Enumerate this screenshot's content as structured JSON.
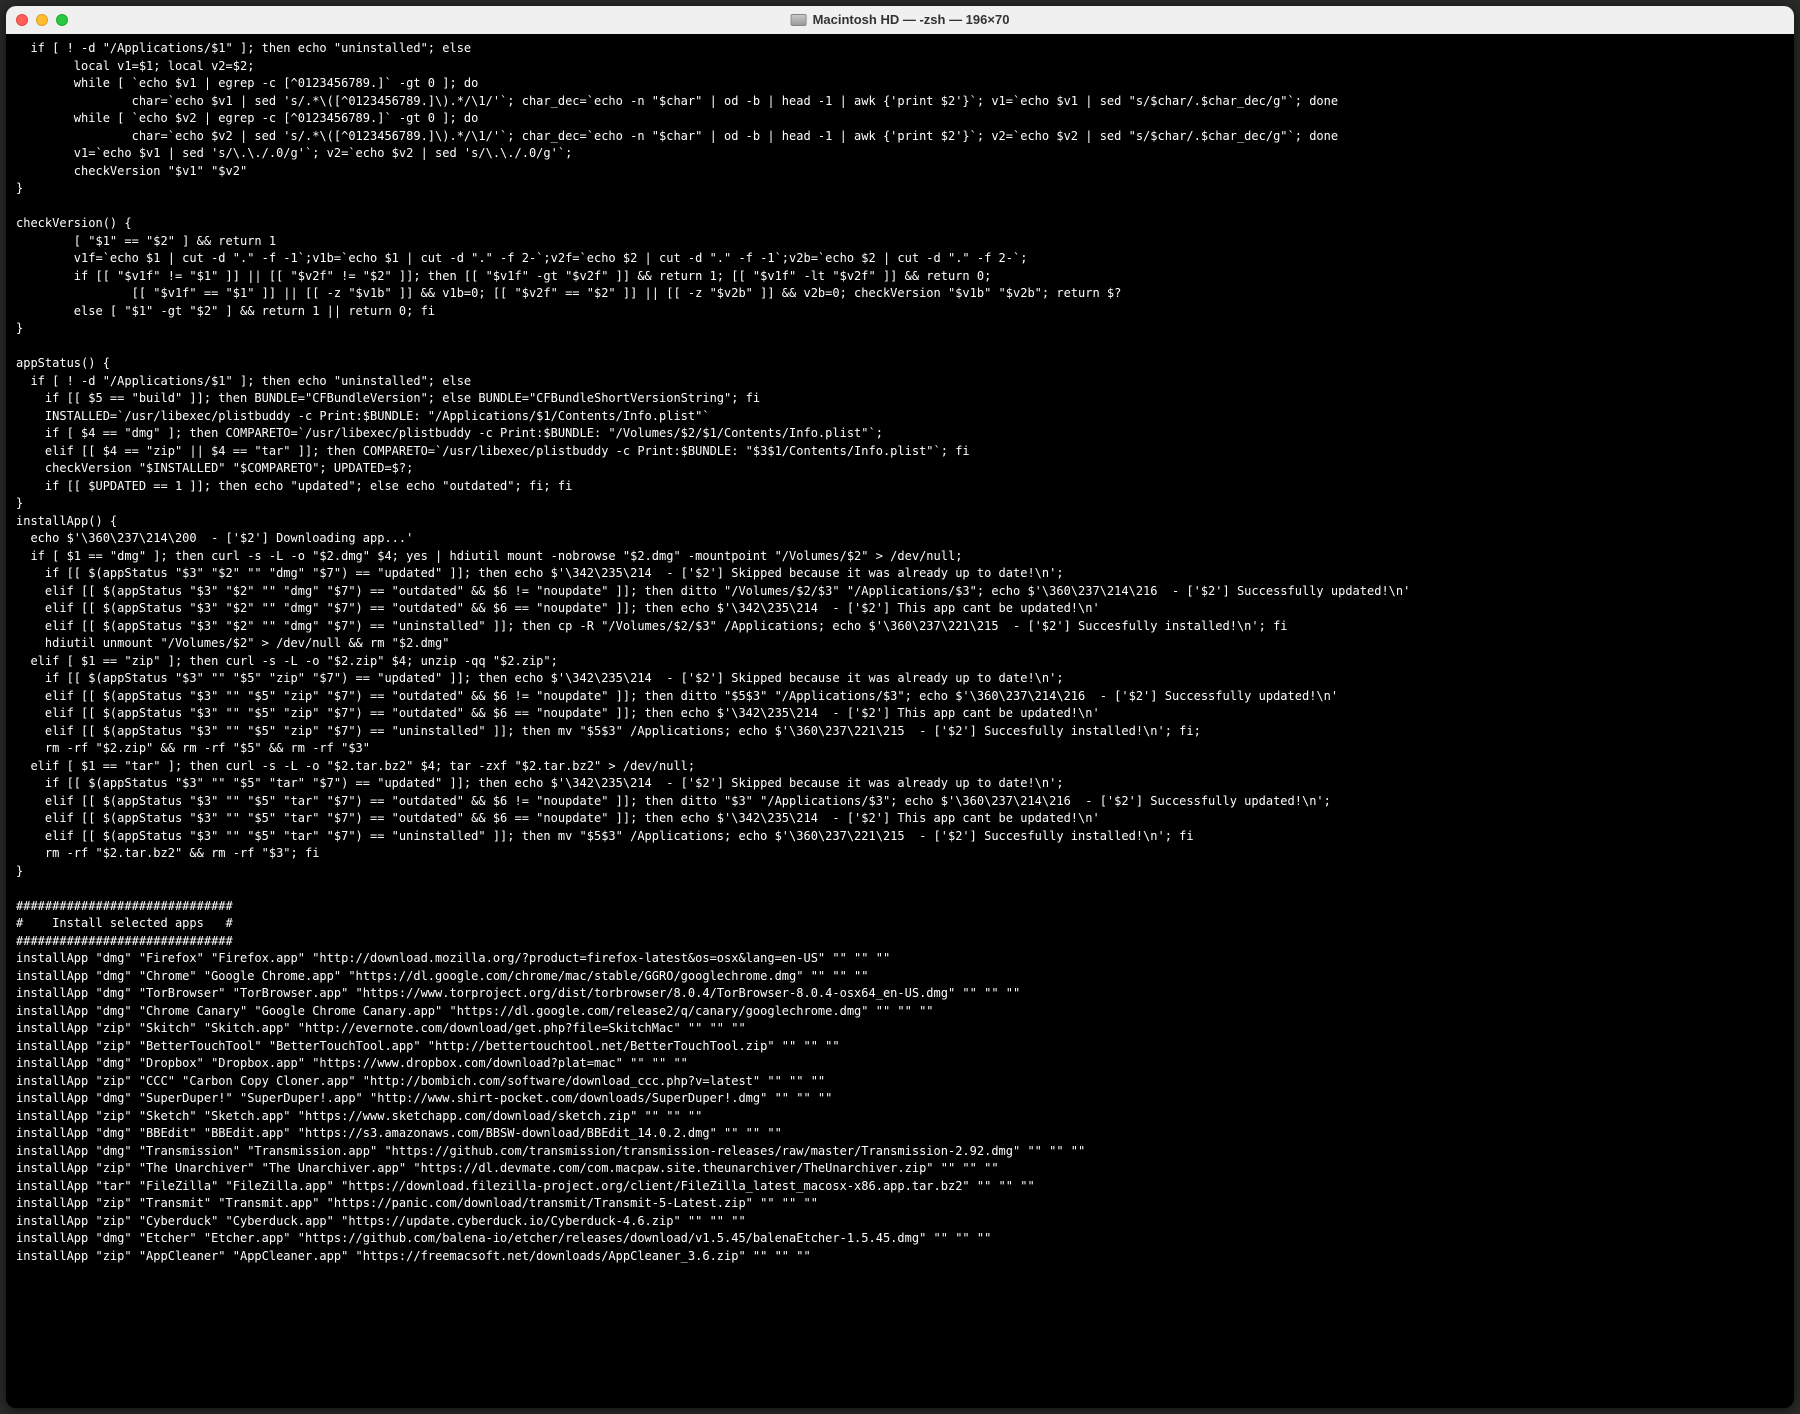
{
  "window": {
    "title": "Macintosh HD — -zsh — 196×70"
  },
  "terminal": {
    "lines": [
      "  if [ ! -d \"/Applications/$1\" ]; then echo \"uninstalled\"; else",
      "        local v1=$1; local v2=$2;",
      "        while [ `echo $v1 | egrep -c [^0123456789.]` -gt 0 ]; do",
      "                char=`echo $v1 | sed 's/.*\\([^0123456789.]\\).*/\\1/'`; char_dec=`echo -n \"$char\" | od -b | head -1 | awk {'print $2'}`; v1=`echo $v1 | sed \"s/$char/.$char_dec/g\"`; done",
      "        while [ `echo $v2 | egrep -c [^0123456789.]` -gt 0 ]; do",
      "                char=`echo $v2 | sed 's/.*\\([^0123456789.]\\).*/\\1/'`; char_dec=`echo -n \"$char\" | od -b | head -1 | awk {'print $2'}`; v2=`echo $v2 | sed \"s/$char/.$char_dec/g\"`; done",
      "        v1=`echo $v1 | sed 's/\\.\\./.0/g'`; v2=`echo $v2 | sed 's/\\.\\./.0/g'`;",
      "        checkVersion \"$v1\" \"$v2\"",
      "}",
      "",
      "checkVersion() {",
      "        [ \"$1\" == \"$2\" ] && return 1",
      "        v1f=`echo $1 | cut -d \".\" -f -1`;v1b=`echo $1 | cut -d \".\" -f 2-`;v2f=`echo $2 | cut -d \".\" -f -1`;v2b=`echo $2 | cut -d \".\" -f 2-`;",
      "        if [[ \"$v1f\" != \"$1\" ]] || [[ \"$v2f\" != \"$2\" ]]; then [[ \"$v1f\" -gt \"$v2f\" ]] && return 1; [[ \"$v1f\" -lt \"$v2f\" ]] && return 0;",
      "                [[ \"$v1f\" == \"$1\" ]] || [[ -z \"$v1b\" ]] && v1b=0; [[ \"$v2f\" == \"$2\" ]] || [[ -z \"$v2b\" ]] && v2b=0; checkVersion \"$v1b\" \"$v2b\"; return $?",
      "        else [ \"$1\" -gt \"$2\" ] && return 1 || return 0; fi",
      "}",
      "",
      "appStatus() {",
      "  if [ ! -d \"/Applications/$1\" ]; then echo \"uninstalled\"; else",
      "    if [[ $5 == \"build\" ]]; then BUNDLE=\"CFBundleVersion\"; else BUNDLE=\"CFBundleShortVersionString\"; fi",
      "    INSTALLED=`/usr/libexec/plistbuddy -c Print:$BUNDLE: \"/Applications/$1/Contents/Info.plist\"`",
      "    if [ $4 == \"dmg\" ]; then COMPARETO=`/usr/libexec/plistbuddy -c Print:$BUNDLE: \"/Volumes/$2/$1/Contents/Info.plist\"`;",
      "    elif [[ $4 == \"zip\" || $4 == \"tar\" ]]; then COMPARETO=`/usr/libexec/plistbuddy -c Print:$BUNDLE: \"$3$1/Contents/Info.plist\"`; fi",
      "    checkVersion \"$INSTALLED\" \"$COMPARETO\"; UPDATED=$?;",
      "    if [[ $UPDATED == 1 ]]; then echo \"updated\"; else echo \"outdated\"; fi; fi",
      "}",
      "installApp() {",
      "  echo $'\\360\\237\\214\\200  - ['$2'] Downloading app...'",
      "  if [ $1 == \"dmg\" ]; then curl -s -L -o \"$2.dmg\" $4; yes | hdiutil mount -nobrowse \"$2.dmg\" -mountpoint \"/Volumes/$2\" > /dev/null;",
      "    if [[ $(appStatus \"$3\" \"$2\" \"\" \"dmg\" \"$7\") == \"updated\" ]]; then echo $'\\342\\235\\214  - ['$2'] Skipped because it was already up to date!\\n';",
      "    elif [[ $(appStatus \"$3\" \"$2\" \"\" \"dmg\" \"$7\") == \"outdated\" && $6 != \"noupdate\" ]]; then ditto \"/Volumes/$2/$3\" \"/Applications/$3\"; echo $'\\360\\237\\214\\216  - ['$2'] Successfully updated!\\n'",
      "    elif [[ $(appStatus \"$3\" \"$2\" \"\" \"dmg\" \"$7\") == \"outdated\" && $6 == \"noupdate\" ]]; then echo $'\\342\\235\\214  - ['$2'] This app cant be updated!\\n'",
      "    elif [[ $(appStatus \"$3\" \"$2\" \"\" \"dmg\" \"$7\") == \"uninstalled\" ]]; then cp -R \"/Volumes/$2/$3\" /Applications; echo $'\\360\\237\\221\\215  - ['$2'] Succesfully installed!\\n'; fi",
      "    hdiutil unmount \"/Volumes/$2\" > /dev/null && rm \"$2.dmg\"",
      "  elif [ $1 == \"zip\" ]; then curl -s -L -o \"$2.zip\" $4; unzip -qq \"$2.zip\";",
      "    if [[ $(appStatus \"$3\" \"\" \"$5\" \"zip\" \"$7\") == \"updated\" ]]; then echo $'\\342\\235\\214  - ['$2'] Skipped because it was already up to date!\\n';",
      "    elif [[ $(appStatus \"$3\" \"\" \"$5\" \"zip\" \"$7\") == \"outdated\" && $6 != \"noupdate\" ]]; then ditto \"$5$3\" \"/Applications/$3\"; echo $'\\360\\237\\214\\216  - ['$2'] Successfully updated!\\n'",
      "    elif [[ $(appStatus \"$3\" \"\" \"$5\" \"zip\" \"$7\") == \"outdated\" && $6 == \"noupdate\" ]]; then echo $'\\342\\235\\214  - ['$2'] This app cant be updated!\\n'",
      "    elif [[ $(appStatus \"$3\" \"\" \"$5\" \"zip\" \"$7\") == \"uninstalled\" ]]; then mv \"$5$3\" /Applications; echo $'\\360\\237\\221\\215  - ['$2'] Succesfully installed!\\n'; fi;",
      "    rm -rf \"$2.zip\" && rm -rf \"$5\" && rm -rf \"$3\"",
      "  elif [ $1 == \"tar\" ]; then curl -s -L -o \"$2.tar.bz2\" $4; tar -zxf \"$2.tar.bz2\" > /dev/null;",
      "    if [[ $(appStatus \"$3\" \"\" \"$5\" \"tar\" \"$7\") == \"updated\" ]]; then echo $'\\342\\235\\214  - ['$2'] Skipped because it was already up to date!\\n';",
      "    elif [[ $(appStatus \"$3\" \"\" \"$5\" \"tar\" \"$7\") == \"outdated\" && $6 != \"noupdate\" ]]; then ditto \"$3\" \"/Applications/$3\"; echo $'\\360\\237\\214\\216  - ['$2'] Successfully updated!\\n';",
      "    elif [[ $(appStatus \"$3\" \"\" \"$5\" \"tar\" \"$7\") == \"outdated\" && $6 == \"noupdate\" ]]; then echo $'\\342\\235\\214  - ['$2'] This app cant be updated!\\n'",
      "    elif [[ $(appStatus \"$3\" \"\" \"$5\" \"tar\" \"$7\") == \"uninstalled\" ]]; then mv \"$5$3\" /Applications; echo $'\\360\\237\\221\\215  - ['$2'] Succesfully installed!\\n'; fi",
      "    rm -rf \"$2.tar.bz2\" && rm -rf \"$3\"; fi",
      "}",
      "",
      "##############################",
      "#    Install selected apps   #",
      "##############################",
      "installApp \"dmg\" \"Firefox\" \"Firefox.app\" \"http://download.mozilla.org/?product=firefox-latest&os=osx&lang=en-US\" \"\" \"\" \"\"",
      "installApp \"dmg\" \"Chrome\" \"Google Chrome.app\" \"https://dl.google.com/chrome/mac/stable/GGRO/googlechrome.dmg\" \"\" \"\" \"\"",
      "installApp \"dmg\" \"TorBrowser\" \"TorBrowser.app\" \"https://www.torproject.org/dist/torbrowser/8.0.4/TorBrowser-8.0.4-osx64_en-US.dmg\" \"\" \"\" \"\"",
      "installApp \"dmg\" \"Chrome Canary\" \"Google Chrome Canary.app\" \"https://dl.google.com/release2/q/canary/googlechrome.dmg\" \"\" \"\" \"\"",
      "installApp \"zip\" \"Skitch\" \"Skitch.app\" \"http://evernote.com/download/get.php?file=SkitchMac\" \"\" \"\" \"\"",
      "installApp \"zip\" \"BetterTouchTool\" \"BetterTouchTool.app\" \"http://bettertouchtool.net/BetterTouchTool.zip\" \"\" \"\" \"\"",
      "installApp \"dmg\" \"Dropbox\" \"Dropbox.app\" \"https://www.dropbox.com/download?plat=mac\" \"\" \"\" \"\"",
      "installApp \"zip\" \"CCC\" \"Carbon Copy Cloner.app\" \"http://bombich.com/software/download_ccc.php?v=latest\" \"\" \"\" \"\"",
      "installApp \"dmg\" \"SuperDuper!\" \"SuperDuper!.app\" \"http://www.shirt-pocket.com/downloads/SuperDuper!.dmg\" \"\" \"\" \"\"",
      "installApp \"zip\" \"Sketch\" \"Sketch.app\" \"https://www.sketchapp.com/download/sketch.zip\" \"\" \"\" \"\"",
      "installApp \"dmg\" \"BBEdit\" \"BBEdit.app\" \"https://s3.amazonaws.com/BBSW-download/BBEdit_14.0.2.dmg\" \"\" \"\" \"\"",
      "installApp \"dmg\" \"Transmission\" \"Transmission.app\" \"https://github.com/transmission/transmission-releases/raw/master/Transmission-2.92.dmg\" \"\" \"\" \"\"",
      "installApp \"zip\" \"The Unarchiver\" \"The Unarchiver.app\" \"https://dl.devmate.com/com.macpaw.site.theunarchiver/TheUnarchiver.zip\" \"\" \"\" \"\"",
      "installApp \"tar\" \"FileZilla\" \"FileZilla.app\" \"https://download.filezilla-project.org/client/FileZilla_latest_macosx-x86.app.tar.bz2\" \"\" \"\" \"\"",
      "installApp \"zip\" \"Transmit\" \"Transmit.app\" \"https://panic.com/download/transmit/Transmit-5-Latest.zip\" \"\" \"\" \"\"",
      "installApp \"zip\" \"Cyberduck\" \"Cyberduck.app\" \"https://update.cyberduck.io/Cyberduck-4.6.zip\" \"\" \"\" \"\"",
      "installApp \"dmg\" \"Etcher\" \"Etcher.app\" \"https://github.com/balena-io/etcher/releases/download/v1.5.45/balenaEtcher-1.5.45.dmg\" \"\" \"\" \"\"",
      "installApp \"zip\" \"AppCleaner\" \"AppCleaner.app\" \"https://freemacsoft.net/downloads/AppCleaner_3.6.zip\" \"\" \"\" \"\""
    ]
  }
}
